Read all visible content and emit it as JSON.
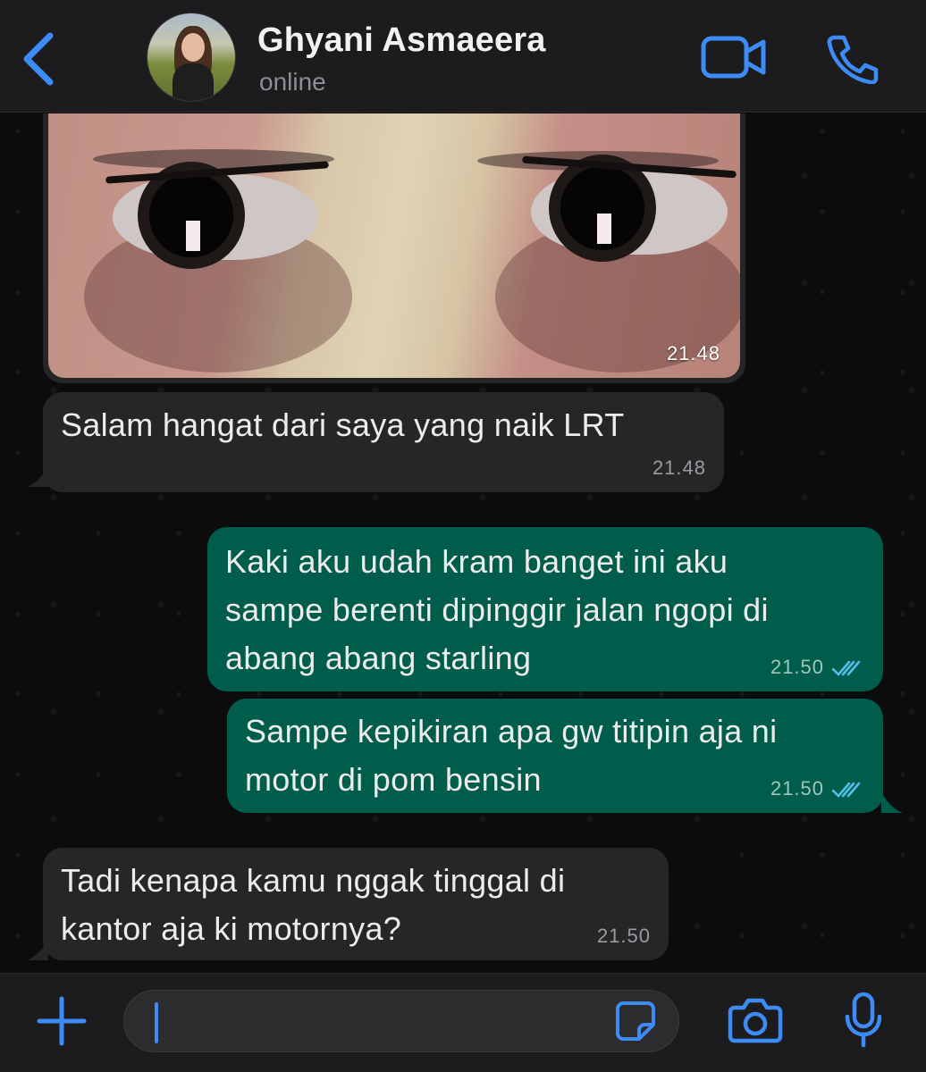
{
  "header": {
    "contact_name": "Ghyani Asmaeera",
    "status": "online"
  },
  "messages": [
    {
      "type": "image",
      "direction": "incoming",
      "time": "21.48"
    },
    {
      "type": "text",
      "direction": "incoming",
      "text": "Salam hangat dari saya yang naik LRT",
      "time": "21.48"
    },
    {
      "type": "text",
      "direction": "outgoing",
      "lines": [
        "Kaki aku udah kram banget ini aku",
        "sampe berenti dipinggir jalan ngopi di",
        "abang abang starling"
      ],
      "time": "21.50",
      "read": true
    },
    {
      "type": "text",
      "direction": "outgoing",
      "lines": [
        "Sampe kepikiran apa gw titipin aja ni",
        "motor di pom bensin"
      ],
      "time": "21.50",
      "read": true
    },
    {
      "type": "text",
      "direction": "incoming",
      "lines": [
        "Tadi kenapa kamu nggak tinggal di",
        "kantor aja ki motornya?"
      ],
      "time": "21.50"
    }
  ],
  "colors": {
    "accent": "#3d8bf5",
    "incoming_bubble": "#262628",
    "outgoing_bubble": "#005c4b",
    "read_ticks": "#53bdeb"
  },
  "icons": [
    "back-chevron-icon",
    "video-call-icon",
    "phone-icon",
    "plus-icon",
    "sticker-icon",
    "camera-icon",
    "microphone-icon"
  ]
}
